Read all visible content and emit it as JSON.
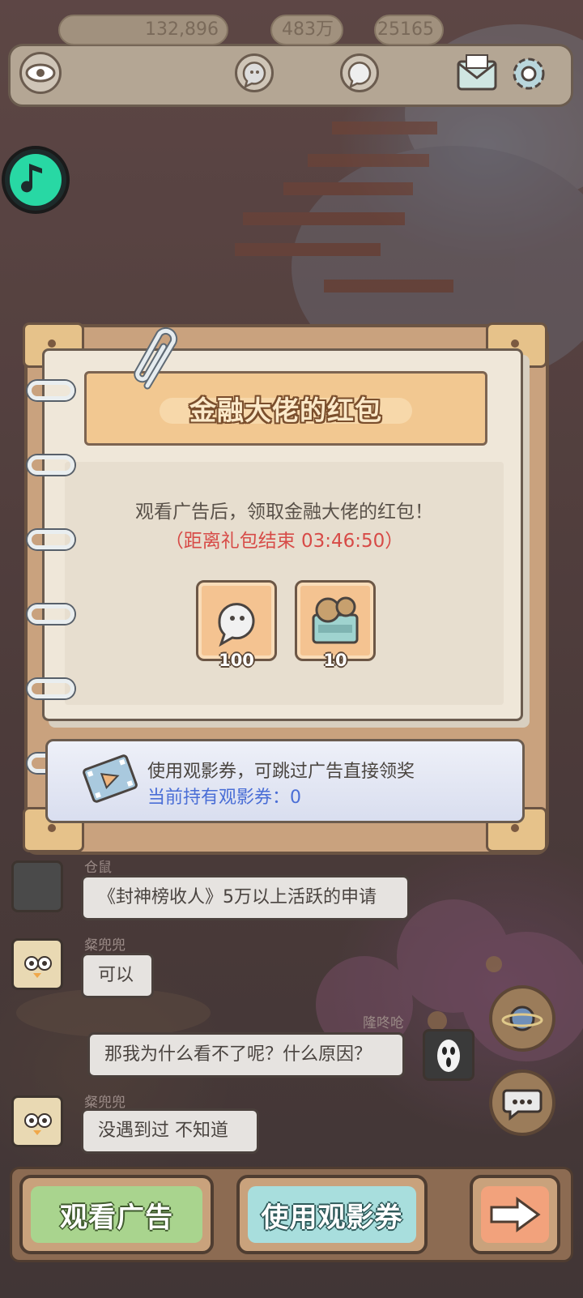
{
  "topbar": {
    "views": "132,896",
    "currency1": "483万",
    "currency2": "25165"
  },
  "dialog": {
    "title": "金融大佬的红包",
    "description": "观看广告后，领取金融大佬的红包！",
    "countdown": "（距离礼包结束  03:46:50）",
    "rewards": [
      {
        "icon": "ghost-bubble-icon",
        "count": "100"
      },
      {
        "icon": "film-chest-icon",
        "count": "10"
      }
    ],
    "ticket_line1": "使用观影券，可跳过广告直接领奖",
    "ticket_line2": "当前持有观影券：0"
  },
  "chat": [
    {
      "user": "仓鼠",
      "text": "《封神榜收人》5万以上活跃的申请"
    },
    {
      "user": "粲兜兜",
      "text": "可以"
    },
    {
      "user": "隆咚呛",
      "text": "那我为什么看不了呢？什么原因？"
    },
    {
      "user": "粲兜兜",
      "text": "没遇到过  不知道"
    }
  ],
  "buttons": {
    "watch_ad": "观看广告",
    "use_ticket": "使用观影券"
  },
  "colors": {
    "watch_ad": "#a9d48e",
    "use_ticket": "#a8dedd",
    "next": "#f2a27c",
    "countdown": "#d74b47",
    "ticket_count": "#4a6ed6"
  }
}
